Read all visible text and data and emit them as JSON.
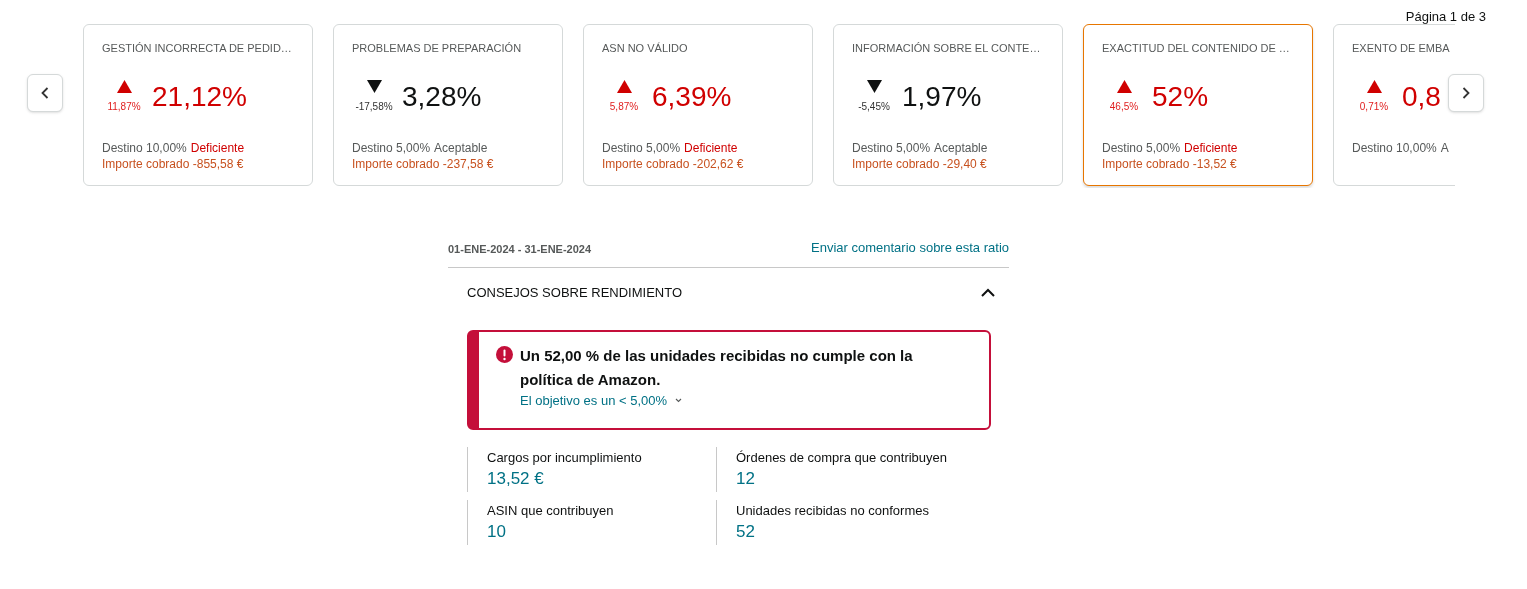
{
  "pagination": "Página 1 de 3",
  "cards": [
    {
      "title": "GESTIÓN INCORRECTA DE PEDID…",
      "rising": true,
      "change": "11,87%",
      "value": "21,12%",
      "target": "Destino 10,00%",
      "status": "Deficiente",
      "deficient": true,
      "charge": "Importe cobrado -855,58 €",
      "selected": false
    },
    {
      "title": "PROBLEMAS DE PREPARACIÓN",
      "rising": false,
      "change": "-17,58%",
      "value": "3,28%",
      "target": "Destino 5,00%",
      "status": "Aceptable",
      "deficient": false,
      "charge": "Importe cobrado -237,58 €",
      "selected": false
    },
    {
      "title": "ASN NO VÁLIDO",
      "rising": true,
      "change": "5,87%",
      "value": "6,39%",
      "target": "Destino 5,00%",
      "status": "Deficiente",
      "deficient": true,
      "charge": "Importe cobrado -202,62 €",
      "selected": false
    },
    {
      "title": "INFORMACIÓN SOBRE EL CONTE…",
      "rising": false,
      "change": "-5,45%",
      "value": "1,97%",
      "target": "Destino 5,00%",
      "status": "Aceptable",
      "deficient": false,
      "charge": "Importe cobrado -29,40 €",
      "selected": false
    },
    {
      "title": "EXACTITUD DEL CONTENIDO DE …",
      "rising": true,
      "change": "46,5%",
      "value": "52%",
      "target": "Destino 5,00%",
      "status": "Deficiente",
      "deficient": true,
      "charge": "Importe cobrado -13,52 €",
      "selected": true
    },
    {
      "title": "EXENTO DE EMBA",
      "rising": true,
      "change": "0,71%",
      "value": "0,8",
      "target": "Destino 10,00%",
      "status": "A",
      "deficient": false,
      "selected": false
    }
  ],
  "date_range": "01-ENE-2024 - 31-ENE-2024",
  "feedback_link": "Enviar comentario sobre esta ratio",
  "section": {
    "title": "CONSEJOS SOBRE RENDIMIENTO",
    "expanded": true
  },
  "alert": {
    "message": "Un 52,00 % de las unidades recibidas no cumple con la política de Amazon.",
    "detail": "El objetivo es un < 5,00%"
  },
  "stats": [
    {
      "label": "Cargos por incumplimiento",
      "value": "13,52 €"
    },
    {
      "label": "Órdenes de compra que contribuyen",
      "value": "12"
    },
    {
      "label": "ASIN que contribuyen",
      "value": "10"
    },
    {
      "label": "Unidades recibidas no conformes",
      "value": "52"
    }
  ]
}
